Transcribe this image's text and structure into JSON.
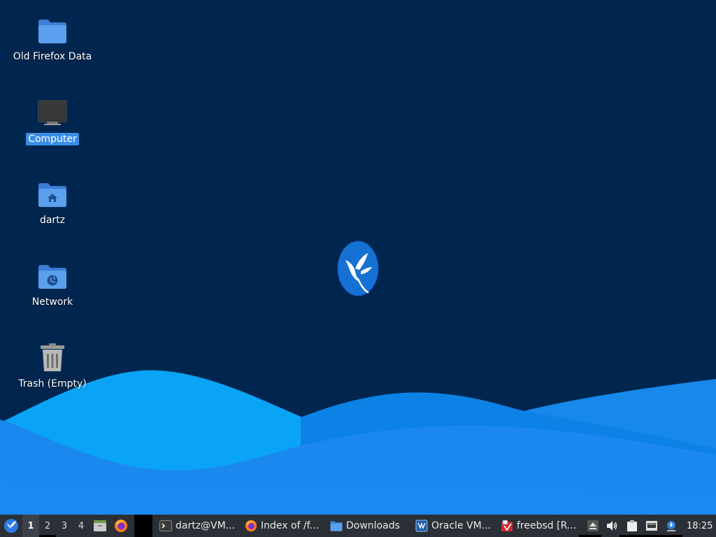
{
  "desktop": {
    "icons": [
      {
        "label": "Old Firefox Data",
        "icon": "folder-icon"
      },
      {
        "label": "Computer",
        "icon": "computer-icon",
        "selected": true
      },
      {
        "label": "dartz",
        "icon": "home-folder-icon"
      },
      {
        "label": "Network",
        "icon": "network-folder-icon"
      },
      {
        "label": "Trash (Empty)",
        "icon": "trash-icon"
      }
    ],
    "logo": "hummingbird-logo"
  },
  "taskbar": {
    "menu_icon": "whisker-menu-icon",
    "workspaces": [
      "1",
      "2",
      "3",
      "4"
    ],
    "active_workspace": "1",
    "launchers": [
      "file-manager-icon",
      "firefox-icon"
    ],
    "tasks": [
      {
        "label": "dartz@VM...",
        "icon": "terminal-icon"
      },
      {
        "label": "Index of /f...",
        "icon": "firefox-icon"
      },
      {
        "label": "Downloads",
        "icon": "folder-icon"
      },
      {
        "label": "Oracle VM...",
        "icon": "virtualbox-icon"
      },
      {
        "label": "freebsd [R...",
        "icon": "virtualbox-vm-icon"
      }
    ],
    "tray": [
      "eject-icon",
      "volume-icon",
      "clipboard-icon",
      "network-wired-icon",
      "update-notifier-icon"
    ],
    "clock": "18:25"
  },
  "colors": {
    "background": "#00264f",
    "wave_light": "#0aa0f5",
    "wave_mid": "#0a7fe0",
    "wave_front": "#1a8af0",
    "selection": "#3a8ee6"
  }
}
